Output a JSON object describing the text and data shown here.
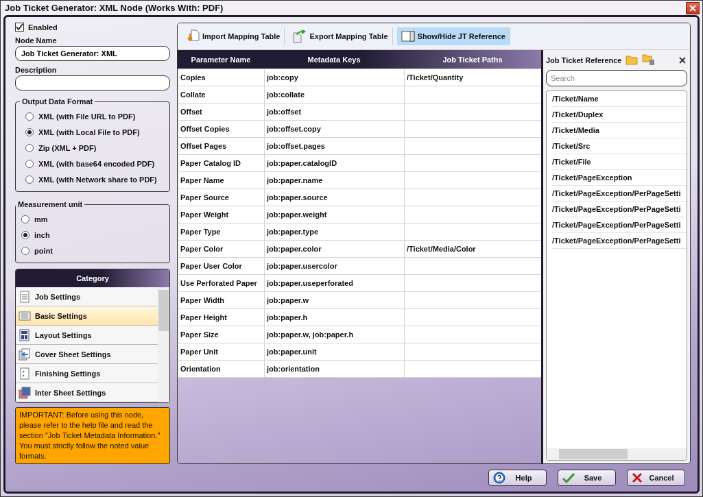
{
  "window": {
    "title": "Job Ticket Generator: XML Node (Works With: PDF)"
  },
  "enabled": {
    "label": "Enabled",
    "checked": true
  },
  "node_name": {
    "label": "Node Name",
    "value": "Job Ticket Generator: XML"
  },
  "description": {
    "label": "Description"
  },
  "output_format": {
    "title": "Output Data Format",
    "options": [
      {
        "label": "XML (with File URL to PDF)",
        "selected": false
      },
      {
        "label": "XML (with Local File to PDF)",
        "selected": true
      },
      {
        "label": "Zip (XML + PDF)",
        "selected": false
      },
      {
        "label": "XML (with base64 encoded PDF)",
        "selected": false
      },
      {
        "label": "XML (with Network share to PDF)",
        "selected": false
      }
    ]
  },
  "measurement_unit": {
    "title": "Measurement unit",
    "options": [
      {
        "label": "mm",
        "selected": false
      },
      {
        "label": "inch",
        "selected": true
      },
      {
        "label": "point",
        "selected": false
      }
    ]
  },
  "category": {
    "title": "Category",
    "items": [
      {
        "label": "Job Settings",
        "selected": false
      },
      {
        "label": "Basic Settings",
        "selected": true
      },
      {
        "label": "Layout Settings",
        "selected": false
      },
      {
        "label": "Cover Sheet Settings",
        "selected": false
      },
      {
        "label": "Finishing Settings",
        "selected": false
      },
      {
        "label": "Inter Sheet Settings",
        "selected": false
      }
    ]
  },
  "notice": "IMPORTANT: Before using this node, please refer to the help file and read the section \"Job Ticket Metadata Information.\" You must strictly follow the noted value formats.",
  "toolbar": [
    {
      "label": "Import Mapping Table",
      "kind": "import",
      "on": false
    },
    {
      "label": "Export Mapping Table",
      "kind": "export",
      "on": false
    },
    {
      "label": "Show/Hide JT Reference",
      "kind": "panel",
      "on": true
    }
  ],
  "table": {
    "columns": [
      "Parameter Name",
      "Metadata Keys",
      "Job Ticket Paths"
    ],
    "rows": [
      {
        "parameter": "Copies",
        "key": "job:copy",
        "path": "/Ticket/Quantity"
      },
      {
        "parameter": "Collate",
        "key": "job:collate"
      },
      {
        "parameter": "Offset",
        "key": "job:offset"
      },
      {
        "parameter": "Offset Copies",
        "key": "job:offset.copy"
      },
      {
        "parameter": "Offset Pages",
        "key": "job:offset.pages"
      },
      {
        "parameter": "Paper Catalog ID",
        "key": "job:paper.catalogID"
      },
      {
        "parameter": "Paper Name",
        "key": "job:paper.name"
      },
      {
        "parameter": "Paper Source",
        "key": "job:paper.source"
      },
      {
        "parameter": "Paper Weight",
        "key": "job:paper.weight"
      },
      {
        "parameter": "Paper Type",
        "key": "job:paper.type"
      },
      {
        "parameter": "Paper Color",
        "key": "job:paper.color",
        "path": "/Ticket/Media/Color"
      },
      {
        "parameter": "Paper User Color",
        "key": "job:paper.usercolor"
      },
      {
        "parameter": "Use Perforated Paper",
        "key": "job:paper.useperforated"
      },
      {
        "parameter": "Paper Width",
        "key": "job:paper.w"
      },
      {
        "parameter": "Paper Height",
        "key": "job:paper.h"
      },
      {
        "parameter": "Paper Size",
        "key": "job:paper.w, job:paper.h"
      },
      {
        "parameter": "Paper Unit",
        "key": "job:paper.unit"
      },
      {
        "parameter": "Orientation",
        "key": "job:orientation"
      }
    ]
  },
  "reference": {
    "title": "Job Ticket Reference",
    "search": {
      "placeholder": "Search"
    },
    "items": [
      "/Ticket/Name",
      "/Ticket/Duplex",
      "/Ticket/Media",
      "/Ticket/Src",
      "/Ticket/File",
      "/Ticket/PageException",
      "/Ticket/PageException/PerPageSetti",
      "/Ticket/PageException/PerPageSetti",
      "/Ticket/PageException/PerPageSetti",
      "/Ticket/PageException/PerPageSetti"
    ]
  },
  "buttons": [
    {
      "label": "Help",
      "kind": "help"
    },
    {
      "label": "Save",
      "kind": "save"
    },
    {
      "label": "Cancel",
      "kind": "cancel"
    }
  ]
}
